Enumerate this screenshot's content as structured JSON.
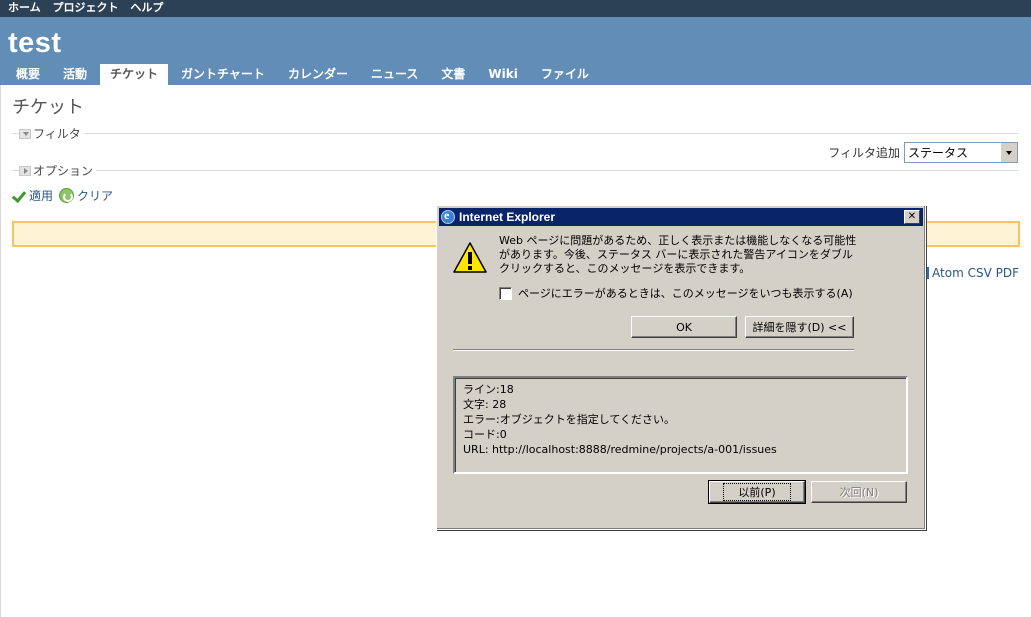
{
  "top_menu": {
    "home": "ホーム",
    "projects": "プロジェクト",
    "help": "ヘルプ"
  },
  "project": {
    "title": "test"
  },
  "tabs": [
    {
      "label": "概要"
    },
    {
      "label": "活動"
    },
    {
      "label": "チケット",
      "selected": true
    },
    {
      "label": "ガントチャート"
    },
    {
      "label": "カレンダー"
    },
    {
      "label": "ニュース"
    },
    {
      "label": "文書"
    },
    {
      "label": "Wiki"
    },
    {
      "label": "ファイル"
    }
  ],
  "page": {
    "title": "チケット",
    "filter_legend": "フィルタ",
    "options_legend": "オプション",
    "add_filter_label": "フィルタ追加",
    "add_filter_value": "ステータス",
    "apply": "適用",
    "clear": "クリア",
    "formats": "Atom CSV PDF"
  },
  "dialog": {
    "title": "Internet Explorer",
    "close": "✕",
    "message": "Web ページに問題があるため、正しく表示または機能しなくなる可能性があります。今後、ステータス バーに表示された警告アイコンをダブルクリックすると、このメッセージを表示できます。",
    "always_show": "ページにエラーがあるときは、このメッセージをいつも表示する(A)",
    "ok": "OK",
    "hide_details": "詳細を隠す(D) <<",
    "details": {
      "line": "ライン:18",
      "char": "文字: 28",
      "error": "エラー:オブジェクトを指定してください。",
      "code": "コード:0",
      "url": "URL: http://localhost:8888/redmine/projects/a-001/issues"
    },
    "prev": "以前(P)",
    "next": "次回(N)"
  },
  "colors": {
    "top_menu_bg": "#2c4056",
    "header_bg": "#628db6",
    "dialog_title_bg": "#0a246a",
    "flash_bg": "#fff3d6",
    "flash_border": "#f4c466"
  }
}
